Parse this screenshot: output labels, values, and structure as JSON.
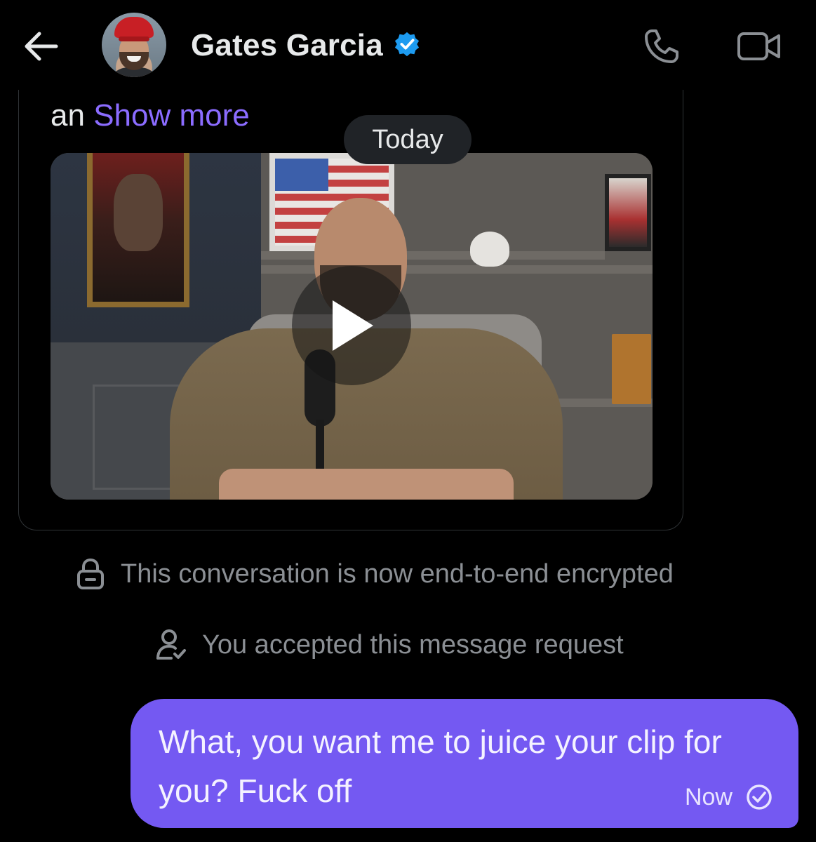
{
  "header": {
    "contact_name": "Gates Garcia",
    "verified": true,
    "icons": {
      "back": "arrow-left-icon",
      "verified": "verified-badge-icon",
      "call": "phone-icon",
      "video": "video-camera-icon"
    }
  },
  "shared_post": {
    "text_prefix": "an",
    "show_more_label": "Show more",
    "media_type": "video",
    "play_icon": "play-icon"
  },
  "date_divider": {
    "label": "Today"
  },
  "system_messages": [
    {
      "icon": "lock-icon",
      "text": "This conversation is now end-to-end encrypted"
    },
    {
      "icon": "person-check-icon",
      "text": "You accepted this message request"
    }
  ],
  "outgoing_message": {
    "text": "What, you want me to juice your clip for you? Fuck off",
    "time": "Now",
    "status_icon": "sent-check-icon"
  },
  "colors": {
    "background": "#000000",
    "accent": "#7459f2",
    "link": "#8b6cff",
    "verified": "#1d9bf0",
    "muted_text": "#8b8f94"
  }
}
